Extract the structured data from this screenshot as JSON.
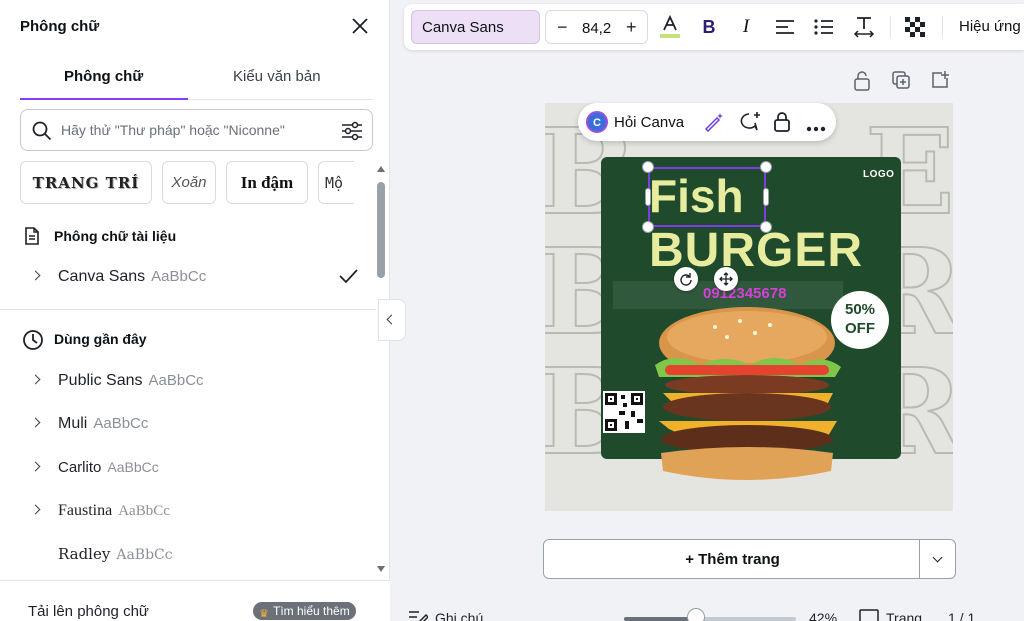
{
  "panel": {
    "title": "Phông chữ",
    "tabs": [
      {
        "label": "Phông chữ",
        "active": true
      },
      {
        "label": "Kiểu văn bản",
        "active": false
      }
    ],
    "search": {
      "placeholder": "Hãy thử \"Thư pháp\" hoặc \"Niconne\"",
      "value": ""
    },
    "chips": [
      "TRANG TRÍ",
      "Xoăn",
      "In đậm",
      "Mộ"
    ],
    "document_fonts": {
      "title": "Phông chữ tài liệu",
      "items": [
        {
          "name": "Canva Sans",
          "sample": "AaBbCc",
          "selected": true
        }
      ]
    },
    "recent": {
      "title": "Dùng gần đây",
      "items": [
        {
          "name": "Public Sans",
          "sample": "AaBbCc"
        },
        {
          "name": "Muli",
          "sample": "AaBbCc"
        },
        {
          "name": "Carlito",
          "sample": "AaBbCc"
        },
        {
          "name": "Faustina",
          "sample": "AaBbCc"
        },
        {
          "name": "Radley",
          "sample": "AaBbCc"
        }
      ]
    },
    "upload_label": "Tải lên phông chữ",
    "learn_more": "Tìm hiểu thêm"
  },
  "toolbar": {
    "font_name": "Canva Sans",
    "font_size": "84,2",
    "minus": "−",
    "plus": "+",
    "effects_label": "Hiệu ứng",
    "text_color": "#c6e07a"
  },
  "canvas": {
    "ask_label": "Hỏi Canva",
    "logo": "LOGO",
    "title_line1": "Fish",
    "title_line2": "BURGER",
    "phone": "0912345678",
    "discount_pct": "50%",
    "discount_text": "OFF",
    "bg_letters": "BURGER",
    "colors": {
      "card": "#1f4a2c",
      "title": "#e7ec9e",
      "phone": "#d63fd8",
      "accent": "#8b3dff"
    }
  },
  "add_page_label": "+ Thêm trang",
  "footer": {
    "notes_label": "Ghi chú",
    "zoom": "42%",
    "zoom_fraction": 0.42,
    "pages_label": "Trang",
    "page_count": "1 / 1"
  }
}
